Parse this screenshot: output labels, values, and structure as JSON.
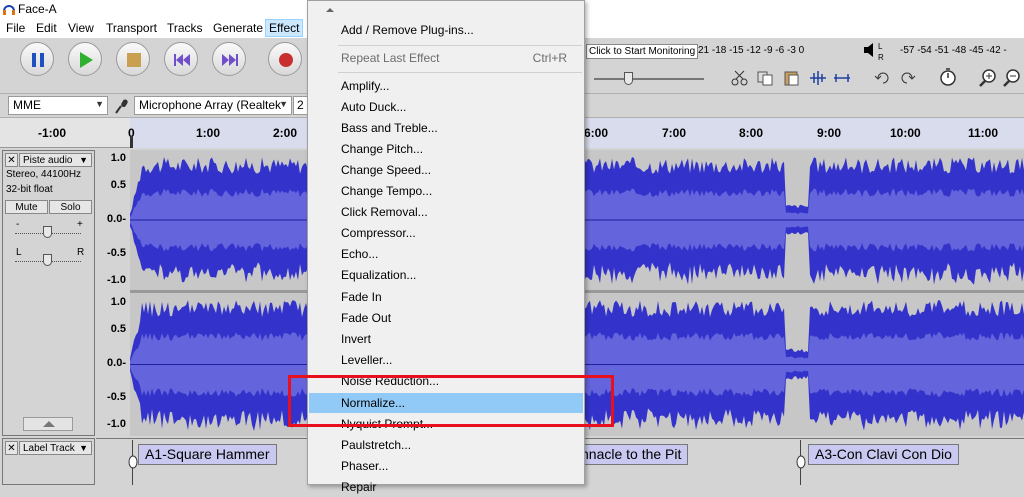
{
  "window": {
    "title": "Face-A"
  },
  "menubar": {
    "items": [
      "File",
      "Edit",
      "View",
      "Transport",
      "Tracks",
      "Generate",
      "Effect"
    ]
  },
  "meter": {
    "monitor_prompt": "Click to Start Monitoring",
    "rec_ticks": [
      "21",
      "-18",
      "-15",
      "-12",
      "-9",
      "-6",
      "-3",
      "0"
    ],
    "play_ticks": [
      "-57",
      "-54",
      "-51",
      "-48",
      "-45",
      "-42",
      "-"
    ]
  },
  "device": {
    "host": "MME",
    "input": "Microphone Array (Realtek",
    "channels": "2"
  },
  "ruler": {
    "ticks": [
      "-1:00",
      "0",
      "1:00",
      "2:00",
      "6:00",
      "7:00",
      "8:00",
      "9:00",
      "10:00",
      "11:00"
    ]
  },
  "audio_track": {
    "name": "Piste audio",
    "info1": "Stereo, 44100Hz",
    "info2": "32-bit float",
    "mute": "Mute",
    "solo": "Solo",
    "gain_minus": "-",
    "gain_plus": "+",
    "pan_left": "L",
    "pan_right": "R",
    "scale": [
      "1.0",
      "0.5",
      "0.0-",
      "-0.5",
      "-1.0"
    ]
  },
  "label_track": {
    "name": "Label Track",
    "labels": [
      "A1-Square Hammer",
      "nnacle to the Pit",
      "A3-Con Clavi Con Dio"
    ]
  },
  "effect_menu": {
    "items": [
      {
        "label": "Add / Remove Plug-ins...",
        "shortcut": ""
      },
      {
        "label": "Repeat Last Effect",
        "shortcut": "Ctrl+R"
      },
      {
        "label": "Amplify...",
        "shortcut": ""
      },
      {
        "label": "Auto Duck...",
        "shortcut": ""
      },
      {
        "label": "Bass and Treble...",
        "shortcut": ""
      },
      {
        "label": "Change Pitch...",
        "shortcut": ""
      },
      {
        "label": "Change Speed...",
        "shortcut": ""
      },
      {
        "label": "Change Tempo...",
        "shortcut": ""
      },
      {
        "label": "Click Removal...",
        "shortcut": ""
      },
      {
        "label": "Compressor...",
        "shortcut": ""
      },
      {
        "label": "Echo...",
        "shortcut": ""
      },
      {
        "label": "Equalization...",
        "shortcut": ""
      },
      {
        "label": "Fade In",
        "shortcut": ""
      },
      {
        "label": "Fade Out",
        "shortcut": ""
      },
      {
        "label": "Invert",
        "shortcut": ""
      },
      {
        "label": "Leveller...",
        "shortcut": ""
      },
      {
        "label": "Noise Reduction...",
        "shortcut": ""
      },
      {
        "label": "Normalize...",
        "shortcut": ""
      },
      {
        "label": "Nyquist Prompt...",
        "shortcut": ""
      },
      {
        "label": "Paulstretch...",
        "shortcut": ""
      },
      {
        "label": "Phaser...",
        "shortcut": ""
      },
      {
        "label": "Repair",
        "shortcut": ""
      }
    ]
  },
  "colors": {
    "waveform": "#3333cc",
    "waveform_rms": "#6464dc",
    "highlight": "#91c9f7",
    "annotation": "#e8101e"
  }
}
